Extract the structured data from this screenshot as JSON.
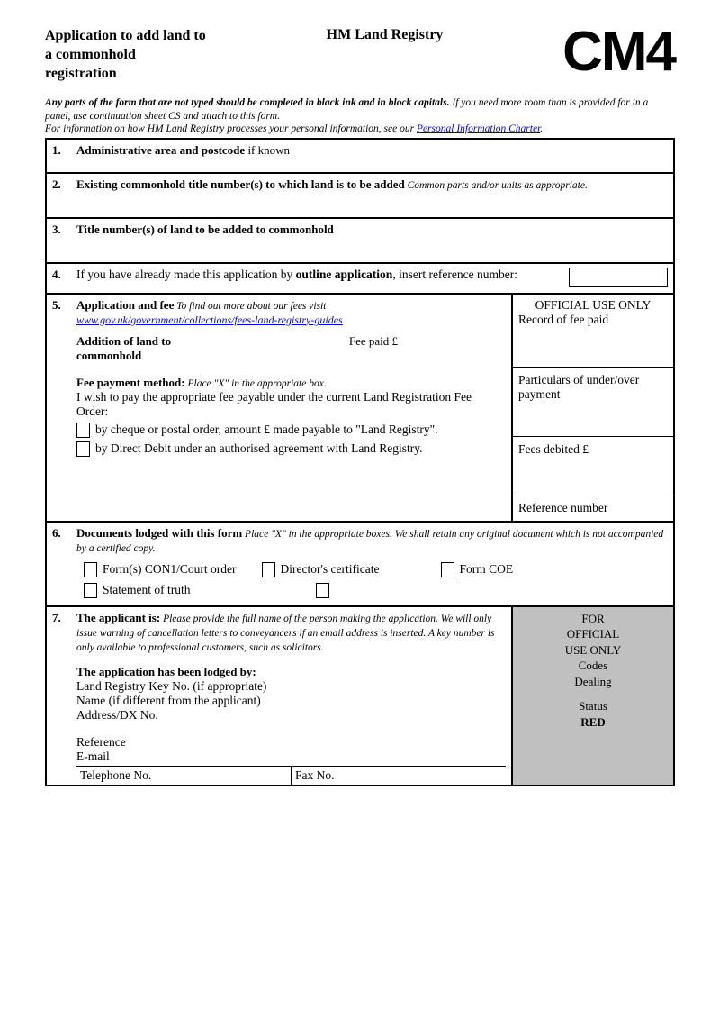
{
  "header": {
    "title": "Application to add land to a commonhold registration",
    "org": "HM Land Registry",
    "code": "CM4"
  },
  "instructions": {
    "bold": "Any parts of the form that are not typed should be completed in black ink and in block capitals.",
    "rest": " If you need more room than is provided for in a panel, use continuation sheet CS and attach to this form.",
    "line2_pre": "For information on how HM Land Registry processes your personal information, see our ",
    "link": "Personal Information Charter",
    "line2_post": "."
  },
  "s1": {
    "num": "1.",
    "heading": "Administrative area and postcode",
    "after": " if known"
  },
  "s2": {
    "num": "2.",
    "heading": "Existing commonhold title number(s) to which land is to be added",
    "note": " Common parts and/or units as appropriate."
  },
  "s3": {
    "num": "3.",
    "heading": "Title number(s) of land to be added to commonhold"
  },
  "s4": {
    "num": "4.",
    "pre": "If you have already made this application by ",
    "bold": "outline application",
    "post": ", insert reference number:"
  },
  "s5": {
    "num": "5.",
    "heading": "Application and fee",
    "note": " To find out more about our fees visit",
    "url": "www.gov.uk/government/collections/fees-land-registry-guides",
    "addition_label": "Addition of land to commonhold",
    "fee_paid": "Fee paid £",
    "fee_method_heading": "Fee payment method:",
    "fee_method_note": " Place \"X\" in the appropriate box.",
    "fee_intro": "I wish to pay the appropriate fee payable under the current Land Registration Fee Order:",
    "opt1": "by cheque or postal order, amount £                                made payable to \"Land Registry\".",
    "opt2": "by Direct Debit under an authorised agreement with Land Registry."
  },
  "official": {
    "title": "OFFICIAL USE ONLY",
    "record": "Record of fee paid",
    "particulars": "Particulars of under/over payment",
    "fees_debited": "Fees debited £",
    "refnum": "Reference number"
  },
  "s6": {
    "num": "6.",
    "heading": "Documents lodged with this form",
    "note": " Place \"X\" in the appropriate boxes.  We shall retain any original document which is not accompanied by a certified copy.",
    "opt1": "Form(s) CON1/Court order",
    "opt2": "Director's certificate",
    "opt3": "Form COE",
    "opt4": "Statement of truth"
  },
  "s7": {
    "num": "7.",
    "heading": "The applicant is:",
    "note": " Please provide the full name of the person making the application. We will only issue warning of cancellation letters to conveyancers if an email address is inserted. A key number is only available to professional customers, such as solicitors.",
    "lodged_heading": "The application has been lodged by:",
    "key": "Land Registry Key No. (if appropriate)",
    "name": "Name (if different from the applicant)",
    "address": "Address/DX No.",
    "reference": "Reference",
    "email": "E-mail",
    "tel": "Telephone No.",
    "fax": "Fax No."
  },
  "sidebar": {
    "line1": "FOR",
    "line2": "OFFICIAL",
    "line3": "USE ONLY",
    "codes": "Codes",
    "dealing": "Dealing",
    "status": "Status",
    "red": "RED"
  }
}
